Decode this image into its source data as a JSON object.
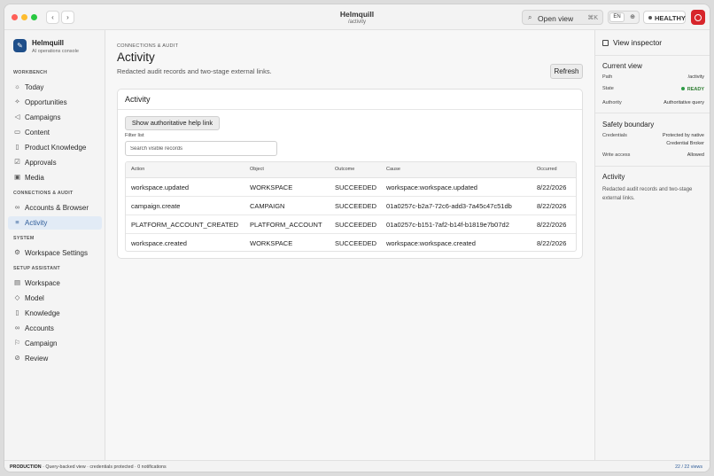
{
  "window": {
    "title": "Helmquill",
    "path": "/activity",
    "open_view_label": "Open view",
    "open_view_shortcut": "⌘K",
    "language": "EN",
    "health_label": "HEALTHY"
  },
  "colors": {
    "accent": "#2f5d9a",
    "close": "#ff5f57",
    "minimize": "#febc2e",
    "maximize": "#28c840",
    "power": "#d7252b",
    "ready": "#2e7d32"
  },
  "brand": {
    "name": "Helmquill",
    "subtitle": "AI operations console"
  },
  "sidebar": {
    "sections": [
      {
        "label": "WORKBENCH",
        "items": [
          {
            "label": "Today",
            "icon": "sun-icon"
          },
          {
            "label": "Opportunities",
            "icon": "sparkle-icon"
          },
          {
            "label": "Campaigns",
            "icon": "megaphone-icon"
          },
          {
            "label": "Content",
            "icon": "document-icon"
          },
          {
            "label": "Product Knowledge",
            "icon": "book-icon"
          },
          {
            "label": "Approvals",
            "icon": "checklist-icon"
          },
          {
            "label": "Media",
            "icon": "image-icon"
          }
        ]
      },
      {
        "label": "CONNECTIONS & AUDIT",
        "items": [
          {
            "label": "Accounts & Browser",
            "icon": "link-icon"
          },
          {
            "label": "Activity",
            "icon": "list-icon",
            "active": true
          }
        ]
      },
      {
        "label": "SYSTEM",
        "items": [
          {
            "label": "Workspace Settings",
            "icon": "gear-icon"
          }
        ]
      },
      {
        "label": "SETUP ASSISTANT",
        "items": [
          {
            "label": "Workspace",
            "icon": "building-icon"
          },
          {
            "label": "Model",
            "icon": "cube-icon"
          },
          {
            "label": "Knowledge",
            "icon": "book-icon"
          },
          {
            "label": "Accounts",
            "icon": "link-icon"
          },
          {
            "label": "Campaign",
            "icon": "flag-icon"
          },
          {
            "label": "Review",
            "icon": "check-circle-icon"
          }
        ]
      }
    ]
  },
  "main": {
    "kicker": "CONNECTIONS & AUDIT",
    "title": "Activity",
    "subtitle": "Redacted audit records and two-stage external links.",
    "refresh_label": "Refresh",
    "card_title": "Activity",
    "help_link_label": "Show authoritative help link",
    "filter_label": "Filter list",
    "filter_placeholder": "Search visible records",
    "columns": [
      "Action",
      "Object",
      "Outcome",
      "Cause",
      "Occurred"
    ],
    "rows": [
      [
        "workspace.updated",
        "WORKSPACE",
        "SUCCEEDED",
        "workspace:workspace.updated",
        "8/22/2026"
      ],
      [
        "campaign.create",
        "CAMPAIGN",
        "SUCCEEDED",
        "01a0257c-b2a7-72c6-add3-7a45c47c51db",
        "8/22/2026"
      ],
      [
        "PLATFORM_ACCOUNT_CREATED",
        "PLATFORM_ACCOUNT",
        "SUCCEEDED",
        "01a0257c-b151-7af2-b14f-b1819e7b07d2",
        "8/22/2026"
      ],
      [
        "workspace.created",
        "WORKSPACE",
        "SUCCEEDED",
        "workspace:workspace.created",
        "8/22/2026"
      ]
    ]
  },
  "inspector": {
    "title": "View inspector",
    "current_view": {
      "heading": "Current view",
      "path_label": "Path",
      "path_value": "/activity",
      "state_label": "State",
      "state_value": "READY",
      "authority_label": "Authority",
      "authority_value": "Authoritative query"
    },
    "safety": {
      "heading": "Safety boundary",
      "credentials_label": "Credentials",
      "credentials_value_1": "Protected by native",
      "credentials_value_2": "Credential Broker",
      "write_label": "Write access",
      "write_value": "Allowed"
    },
    "activity": {
      "heading": "Activity",
      "description": "Redacted audit records and two-stage external links."
    }
  },
  "status": {
    "env": "PRODUCTION",
    "text": "· Query-backed view · credentials protected · 0 notifications",
    "views": "22 / 22 views"
  }
}
